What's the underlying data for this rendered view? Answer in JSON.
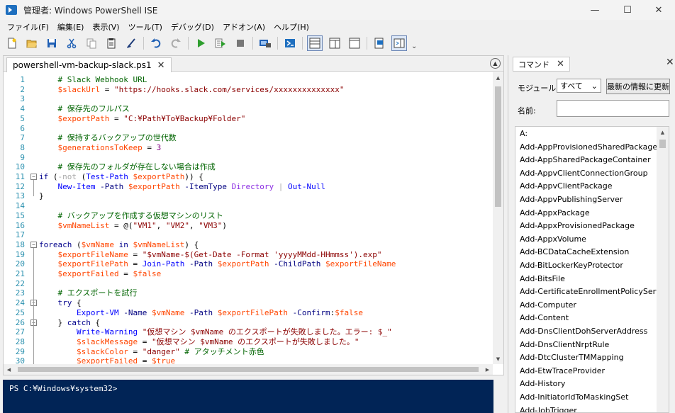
{
  "window": {
    "title": "管理者: Windows PowerShell ISE",
    "minimize": "—",
    "maximize": "☐",
    "close": "✕"
  },
  "menu": [
    "ファイル(F)",
    "編集(E)",
    "表示(V)",
    "ツール(T)",
    "デバッグ(D)",
    "アドオン(A)",
    "ヘルプ(H)"
  ],
  "toolbar": {
    "buttons": [
      "new-file",
      "open-file",
      "save",
      "cut",
      "copy",
      "paste",
      "clear-console",
      "undo",
      "redo",
      "run-script",
      "run-selection",
      "stop",
      "new-remote-tab",
      "start-powershell",
      "show-script-top",
      "show-script-right",
      "show-script-max",
      "show-command-window",
      "show-command-addon"
    ],
    "overflow": "⌄"
  },
  "editor": {
    "tab_label": "powershell-vm-backup-slack.ps1",
    "tab_close": "✕",
    "collapse_glyph": "▲",
    "lines": [
      {
        "n": "1",
        "fold": "",
        "tokens": [
          [
            "c",
            "    # Slack Webhook URL"
          ]
        ]
      },
      {
        "n": "2",
        "fold": "",
        "tokens": [
          [
            "v",
            "    $slackUrl"
          ],
          [
            "p",
            " = "
          ],
          [
            "s",
            "\"https://hooks.slack.com/services/xxxxxxxxxxxxxx\""
          ]
        ]
      },
      {
        "n": "3",
        "fold": "",
        "tokens": []
      },
      {
        "n": "4",
        "fold": "",
        "tokens": [
          [
            "c",
            "    # 保存先のフルパス"
          ]
        ]
      },
      {
        "n": "5",
        "fold": "",
        "tokens": [
          [
            "v",
            "    $exportPath"
          ],
          [
            "p",
            " = "
          ],
          [
            "s",
            "\"C:¥Path¥To¥Backup¥Folder\""
          ]
        ]
      },
      {
        "n": "6",
        "fold": "",
        "tokens": []
      },
      {
        "n": "7",
        "fold": "",
        "tokens": [
          [
            "c",
            "    # 保持するバックアップの世代数"
          ]
        ]
      },
      {
        "n": "8",
        "fold": "",
        "tokens": [
          [
            "v",
            "    $generationsToKeep"
          ],
          [
            "p",
            " = "
          ],
          [
            "num",
            "3"
          ]
        ]
      },
      {
        "n": "9",
        "fold": "",
        "tokens": []
      },
      {
        "n": "10",
        "fold": "",
        "tokens": [
          [
            "c",
            "    # 保存先のフォルダが存在しない場合は作成"
          ]
        ]
      },
      {
        "n": "11",
        "fold": "−",
        "tokens": [
          [
            "k",
            "if"
          ],
          [
            "p",
            " ("
          ],
          [
            "o",
            "-not"
          ],
          [
            "p",
            " ("
          ],
          [
            "m",
            "Test-Path"
          ],
          [
            "v",
            " $exportPath"
          ],
          [
            "p",
            ")) {"
          ]
        ]
      },
      {
        "n": "12",
        "fold": "",
        "tokens": [
          [
            "m",
            "    New-Item"
          ],
          [
            "a",
            " -Path"
          ],
          [
            "v",
            " $exportPath"
          ],
          [
            "a",
            " -ItemType"
          ],
          [
            "t",
            " Directory"
          ],
          [
            "o",
            " |"
          ],
          [
            "m",
            " Out-Null"
          ]
        ]
      },
      {
        "n": "13",
        "fold": "",
        "tokens": [
          [
            "p",
            "}"
          ]
        ]
      },
      {
        "n": "14",
        "fold": "",
        "tokens": []
      },
      {
        "n": "15",
        "fold": "",
        "tokens": [
          [
            "c",
            "    # バックアップを作成する仮想マシンのリスト"
          ]
        ]
      },
      {
        "n": "16",
        "fold": "",
        "tokens": [
          [
            "v",
            "    $vmNameList"
          ],
          [
            "p",
            " = @("
          ],
          [
            "s",
            "\"VM1\""
          ],
          [
            "p",
            ", "
          ],
          [
            "s",
            "\"VM2\""
          ],
          [
            "p",
            ", "
          ],
          [
            "s",
            "\"VM3\""
          ],
          [
            "p",
            ")"
          ]
        ]
      },
      {
        "n": "17",
        "fold": "",
        "tokens": []
      },
      {
        "n": "18",
        "fold": "−",
        "tokens": [
          [
            "k",
            "foreach"
          ],
          [
            "p",
            " ("
          ],
          [
            "v",
            "$vmName"
          ],
          [
            "k",
            " in"
          ],
          [
            "v",
            " $vmNameList"
          ],
          [
            "p",
            ") {"
          ]
        ]
      },
      {
        "n": "19",
        "fold": "",
        "tokens": [
          [
            "v",
            "    $exportFileName"
          ],
          [
            "p",
            " = "
          ],
          [
            "s",
            "\"$vmName-$(Get-Date -Format 'yyyyMMdd-HHmmss').exp\""
          ]
        ]
      },
      {
        "n": "20",
        "fold": "",
        "tokens": [
          [
            "v",
            "    $exportFilePath"
          ],
          [
            "p",
            " = "
          ],
          [
            "m",
            "Join-Path"
          ],
          [
            "a",
            " -Path"
          ],
          [
            "v",
            " $exportPath"
          ],
          [
            "a",
            " -ChildPath"
          ],
          [
            "v",
            " $exportFileName"
          ]
        ]
      },
      {
        "n": "21",
        "fold": "",
        "tokens": [
          [
            "v",
            "    $exportFailed"
          ],
          [
            "p",
            " = "
          ],
          [
            "v",
            "$false"
          ]
        ]
      },
      {
        "n": "22",
        "fold": "",
        "tokens": []
      },
      {
        "n": "23",
        "fold": "",
        "tokens": [
          [
            "c",
            "    # エクスポートを試行"
          ]
        ]
      },
      {
        "n": "24",
        "fold": "−",
        "tokens": [
          [
            "k",
            "    try"
          ],
          [
            "p",
            " {"
          ]
        ]
      },
      {
        "n": "25",
        "fold": "",
        "tokens": [
          [
            "m",
            "        Export-VM"
          ],
          [
            "a",
            " -Name"
          ],
          [
            "v",
            " $vmName"
          ],
          [
            "a",
            " -Path"
          ],
          [
            "v",
            " $exportFilePath"
          ],
          [
            "a",
            " -Confirm"
          ],
          [
            "p",
            ":"
          ],
          [
            "v",
            "$false"
          ]
        ]
      },
      {
        "n": "26",
        "fold": "−",
        "tokens": [
          [
            "p",
            "    } "
          ],
          [
            "k",
            "catch"
          ],
          [
            "p",
            " {"
          ]
        ]
      },
      {
        "n": "27",
        "fold": "",
        "tokens": [
          [
            "m",
            "        Write-Warning"
          ],
          [
            "s",
            " \"仮想マシン $vmName のエクスポートが失敗しました。エラー: $_\""
          ]
        ]
      },
      {
        "n": "28",
        "fold": "",
        "tokens": [
          [
            "v",
            "        $slackMessage"
          ],
          [
            "p",
            " = "
          ],
          [
            "s",
            "\"仮想マシン $vmName のエクスポートが失敗しました。\""
          ]
        ]
      },
      {
        "n": "29",
        "fold": "",
        "tokens": [
          [
            "v",
            "        $slackColor"
          ],
          [
            "p",
            " = "
          ],
          [
            "s",
            "\"danger\""
          ],
          [
            "c",
            " # アタッチメント赤色"
          ]
        ]
      },
      {
        "n": "30",
        "fold": "",
        "tokens": [
          [
            "v",
            "        $exportFailed"
          ],
          [
            "p",
            " = "
          ],
          [
            "v",
            "$true"
          ]
        ]
      }
    ]
  },
  "console": {
    "prompt": "PS C:¥Windows¥system32>"
  },
  "commands": {
    "tab_label": "コマンド",
    "tab_close": "✕",
    "panel_close": "✕",
    "module_label": "モジュール:",
    "module_value": "すべて",
    "refresh_label": "最新の情報に更新",
    "name_label": "名前:",
    "name_value": "",
    "items": [
      "A:",
      "Add-AppProvisionedSharedPackageContainer",
      "Add-AppSharedPackageContainer",
      "Add-AppvClientConnectionGroup",
      "Add-AppvClientPackage",
      "Add-AppvPublishingServer",
      "Add-AppxPackage",
      "Add-AppxProvisionedPackage",
      "Add-AppxVolume",
      "Add-BCDataCacheExtension",
      "Add-BitLockerKeyProtector",
      "Add-BitsFile",
      "Add-CertificateEnrollmentPolicyServer",
      "Add-Computer",
      "Add-Content",
      "Add-DnsClientDohServerAddress",
      "Add-DnsClientNrptRule",
      "Add-DtcClusterTMMapping",
      "Add-EtwTraceProvider",
      "Add-History",
      "Add-InitiatorIdToMaskingSet",
      "Add-JobTrigger"
    ]
  }
}
